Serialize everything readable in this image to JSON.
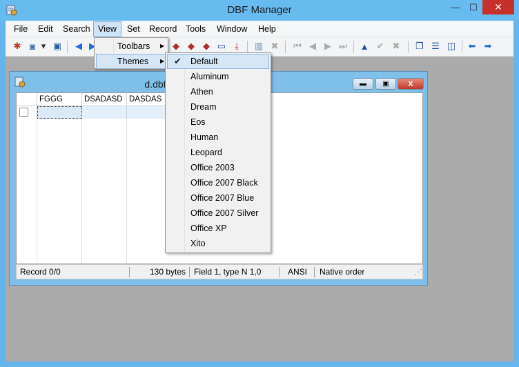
{
  "app": {
    "title": "DBF Manager",
    "minimize_glyph": "—",
    "maximize_glyph": "☐",
    "close_glyph": "✕"
  },
  "menubar": {
    "items": [
      "File",
      "Edit",
      "Search",
      "View",
      "Set",
      "Record",
      "Tools",
      "Window",
      "Help"
    ]
  },
  "view_menu": {
    "items": [
      {
        "label": "Toolbars",
        "submenu_arrow": "▶"
      },
      {
        "label": "Themes",
        "submenu_arrow": "▶"
      }
    ]
  },
  "themes_menu": {
    "selected": "Default",
    "check_glyph": "✔",
    "items": [
      "Default",
      "Aluminum",
      "Athen",
      "Dream",
      "Eos",
      "Human",
      "Leopard",
      "Office 2003",
      "Office 2007 Black",
      "Office 2007 Blue",
      "Office 2007 Silver",
      "Office XP",
      "Xito"
    ]
  },
  "child_window": {
    "title": "d.dbf - C:\\Users\\                           .dbf",
    "minimize_glyph": "▬",
    "maximize_glyph": "▣",
    "close_glyph": "X"
  },
  "grid": {
    "columns": [
      "FGGG",
      "DSADASD",
      "DASDAS"
    ]
  },
  "status_bar": {
    "record": "Record 0/0",
    "size": "130 bytes",
    "field": "Field 1, type N 1,0",
    "encoding": "ANSI",
    "order": "Native order",
    "grip_glyph": "⋰"
  },
  "toolbar": {
    "icons": [
      {
        "name": "new-icon",
        "glyph": "✱",
        "color": "#c0392b"
      },
      {
        "name": "database-icon",
        "glyph": "◙",
        "color": "#3b6ea8"
      },
      {
        "name": "dropdown-icon",
        "glyph": "▾",
        "color": "#333333"
      },
      {
        "name": "save-icon",
        "glyph": "▣",
        "color": "#2b5d9a"
      },
      {
        "name": "back-icon",
        "glyph": "◀",
        "color": "#1f6fd6"
      },
      {
        "name": "forward-icon",
        "glyph": "▶",
        "color": "#1f6fd6"
      },
      {
        "name": "record-edit-icon",
        "glyph": "◆",
        "color": "#b03030"
      },
      {
        "name": "record-add-icon",
        "glyph": "◆",
        "color": "#b03030"
      },
      {
        "name": "record-copy-icon",
        "glyph": "◆",
        "color": "#b03030"
      },
      {
        "name": "row-delete-icon",
        "glyph": "▭",
        "color": "#1f4fa0"
      },
      {
        "name": "download-icon",
        "glyph": "⤓",
        "color": "#c0392b"
      },
      {
        "name": "trash-icon",
        "glyph": "▥",
        "color": "#6f8aa8"
      },
      {
        "name": "cancel-icon",
        "glyph": "✖",
        "color": "#aaaaaa"
      },
      {
        "name": "first-icon",
        "glyph": "⏮",
        "color": "#aaaaaa"
      },
      {
        "name": "prev-icon",
        "glyph": "◀",
        "color": "#aaaaaa"
      },
      {
        "name": "next-icon",
        "glyph": "▶",
        "color": "#aaaaaa"
      },
      {
        "name": "last-icon",
        "glyph": "⏭",
        "color": "#aaaaaa"
      },
      {
        "name": "up-icon",
        "glyph": "▲",
        "color": "#1f4fa0"
      },
      {
        "name": "confirm-icon",
        "glyph": "✔",
        "color": "#aaaaaa"
      },
      {
        "name": "discard-icon",
        "glyph": "✖",
        "color": "#aaaaaa"
      },
      {
        "name": "cascade-icon",
        "glyph": "❐",
        "color": "#1f4fa0"
      },
      {
        "name": "tile-horizontal-icon",
        "glyph": "☰",
        "color": "#1f4fa0"
      },
      {
        "name": "tile-vertical-icon",
        "glyph": "◫",
        "color": "#1f4fa0"
      },
      {
        "name": "arrow-left-icon",
        "glyph": "⬅",
        "color": "#1f6fd6"
      },
      {
        "name": "arrow-right-icon",
        "glyph": "➡",
        "color": "#1f6fd6"
      }
    ]
  }
}
